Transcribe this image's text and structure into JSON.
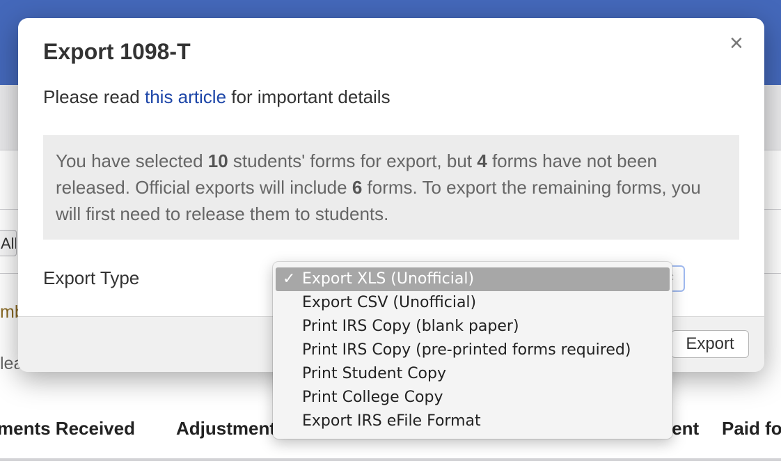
{
  "background": {
    "select_stub_text": "All",
    "orange_text": "mb",
    "gray_text": "leas",
    "columns": [
      "ments Received",
      "Adjustment",
      "ment",
      "Paid fo"
    ]
  },
  "modal": {
    "title": "Export 1098-T",
    "close_label": "×",
    "subtitle_before": "Please read ",
    "subtitle_link": "this article",
    "subtitle_after": " for important details",
    "notice": {
      "p1": "You have selected ",
      "selected_count": "10",
      "p2": " students' forms for export, but ",
      "unreleased_count": "4",
      "p3": " forms have not been released. Official exports will include ",
      "included_count": "6",
      "p4": " forms. To export the remaining forms, you will first need to release them to students."
    },
    "export_type_label": "Export Type",
    "select_arrows": "⇕",
    "export_button": "Export"
  },
  "dropdown": {
    "check_icon": "✓",
    "options": [
      "Export XLS (Unofficial)",
      "Export CSV (Unofficial)",
      "Print IRS Copy (blank paper)",
      "Print IRS Copy (pre-printed forms required)",
      "Print Student Copy",
      "Print College Copy",
      "Export IRS eFile Format"
    ],
    "selected_index": 0
  }
}
